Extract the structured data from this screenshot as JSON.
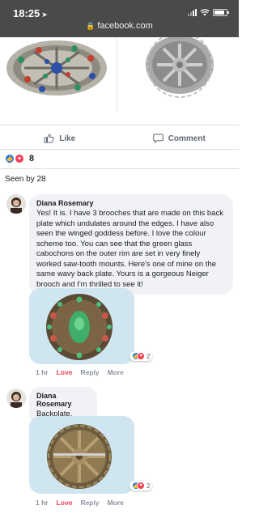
{
  "status_bar": {
    "time": "18:25",
    "url": "facebook.com"
  },
  "post": {
    "actions": {
      "like_label": "Like",
      "comment_label": "Comment"
    },
    "reaction_count": "8",
    "seen_by": "Seen by 28"
  },
  "comments": [
    {
      "author": "Diana Rosemary",
      "text": "Yes! It is. I have 3 brooches that are made on this back plate which undulates around the edges. I have also seen the winged goddess before. I love the colour scheme too. You can see that the green glass cabochons on the outer rim are set in very finely worked saw-tooth mounts. Here's one of mine on the same wavy back plate. Yours is a gorgeous Neiger brooch and I'm thrilled to see it!",
      "image_reactions": "2",
      "meta": {
        "time": "1 hr",
        "reaction": "Love",
        "reply": "Reply",
        "more": "More"
      }
    },
    {
      "author": "Diana Rosemary",
      "text": "Backplate.",
      "image_reactions": "2",
      "meta": {
        "time": "1 hr",
        "reaction": "Love",
        "reply": "Reply",
        "more": "More"
      }
    }
  ],
  "colors": {
    "like_blue": "#1877f2",
    "love_red": "#f33e58",
    "status_bar": "#4a4a4a",
    "bubble": "#f0f2f5"
  },
  "icons": [
    "location-arrow-icon",
    "signal-icon",
    "wifi-icon",
    "battery-icon",
    "lock-icon",
    "like-icon",
    "comment-icon",
    "like-reaction-icon",
    "love-reaction-icon"
  ]
}
